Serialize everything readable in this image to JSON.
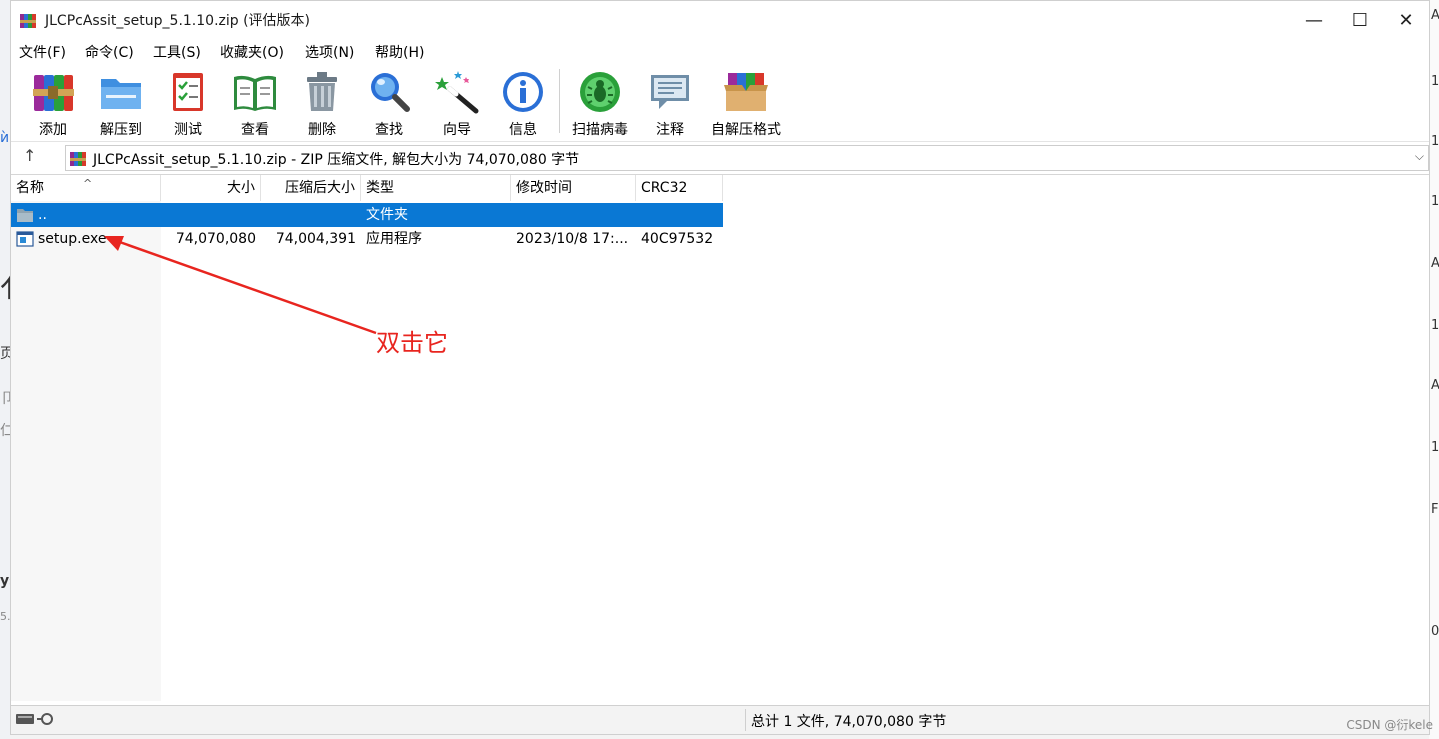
{
  "window": {
    "title": "JLCPcAssit_setup_5.1.10.zip (评估版本)",
    "minimize": "—",
    "maximize": "☐",
    "close": "✕"
  },
  "menu": [
    "文件(F)",
    "命令(C)",
    "工具(S)",
    "收藏夹(O)",
    "选项(N)",
    "帮助(H)"
  ],
  "toolbar": [
    {
      "label": "添加",
      "icon": "add-archive-icon"
    },
    {
      "label": "解压到",
      "icon": "extract-to-icon"
    },
    {
      "label": "测试",
      "icon": "test-icon"
    },
    {
      "label": "查看",
      "icon": "view-icon"
    },
    {
      "label": "删除",
      "icon": "delete-icon"
    },
    {
      "label": "查找",
      "icon": "find-icon"
    },
    {
      "label": "向导",
      "icon": "wizard-icon"
    },
    {
      "label": "信息",
      "icon": "info-icon"
    },
    {
      "label": "扫描病毒",
      "icon": "virus-scan-icon"
    },
    {
      "label": "注释",
      "icon": "comment-icon"
    },
    {
      "label": "自解压格式",
      "icon": "sfx-icon"
    }
  ],
  "address": {
    "text": "JLCPcAssit_setup_5.1.10.zip - ZIP 压缩文件, 解包大小为 74,070,080 字节",
    "up": "↑",
    "dropdown": "⌵"
  },
  "columns": {
    "name": "名称",
    "size": "大小",
    "packed": "压缩后大小",
    "type": "类型",
    "modified": "修改时间",
    "crc": "CRC32",
    "sort_indicator": "^"
  },
  "files": [
    {
      "name": "..",
      "size": "",
      "packed": "",
      "type": "文件夹",
      "modified": "",
      "crc": "",
      "selected": true,
      "icon": "folder-icon"
    },
    {
      "name": "setup.exe",
      "size": "74,070,080",
      "packed": "74,004,391",
      "type": "应用程序",
      "modified": "2023/10/8 17:...",
      "crc": "40C97532",
      "selected": false,
      "icon": "exe-file-icon"
    }
  ],
  "status": {
    "text": "总计 1 文件, 74,070,080 字节"
  },
  "annotation": "双击它",
  "watermark": "CSDN @衍kele",
  "background_edge": {
    "right": [
      "A",
      "1",
      "1(",
      "1(",
      "A",
      "1",
      "A",
      "1",
      "F",
      "0"
    ],
    "left": [
      "ѝ",
      "亻",
      "页",
      "卩",
      "仁",
      "ys",
      "5."
    ]
  },
  "colors": {
    "selection": "#0a78d4",
    "annotation": "#e8251f"
  }
}
